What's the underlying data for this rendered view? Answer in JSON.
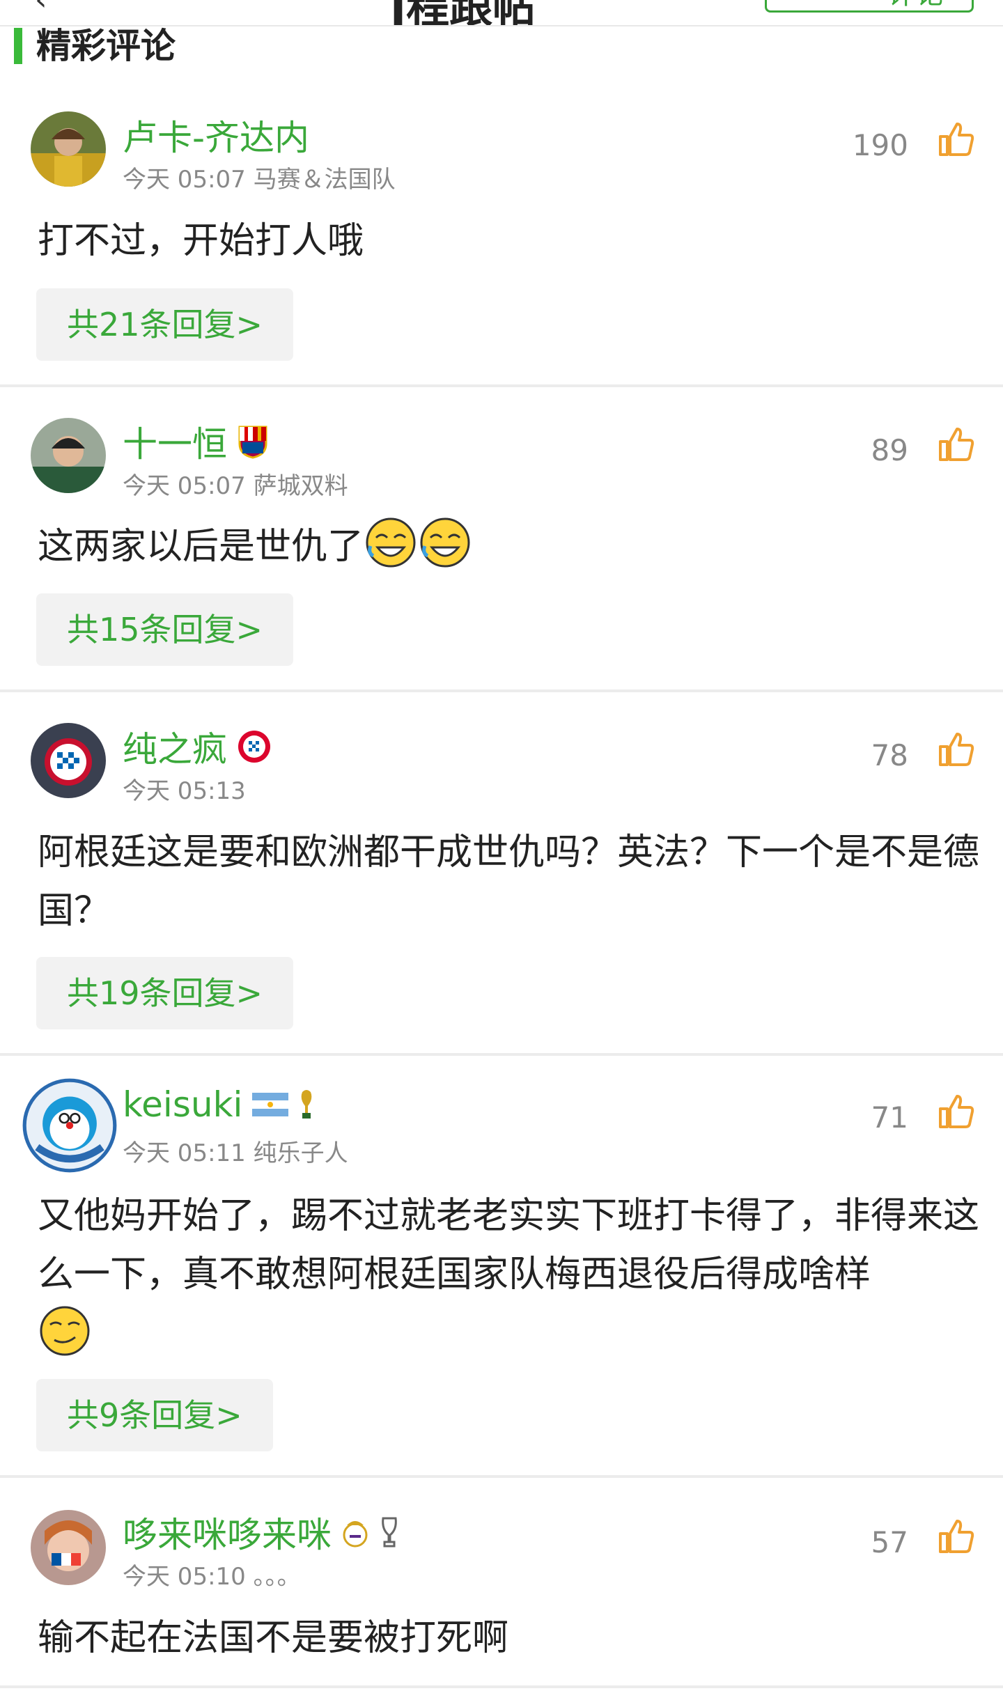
{
  "header": {
    "back_icon": "back-arrow-icon",
    "title": "ǀ程跟帖",
    "write_label": "评论"
  },
  "section": {
    "title": "精彩评论"
  },
  "comments": [
    {
      "username": "卢卡-齐达内",
      "time": "今天 05:07",
      "tag": "马赛＆法国队",
      "likes": "190",
      "text": "打不过，开始打人哦",
      "replies": "共21条回复>"
    },
    {
      "username": "十一恒",
      "time": "今天 05:07",
      "tag": "萨城双料",
      "likes": "89",
      "text": "这两家以后是世仇了",
      "replies": "共15条回复>"
    },
    {
      "username": "纯之疯",
      "time": "今天 05:13",
      "tag": "",
      "likes": "78",
      "text": "阿根廷这是要和欧洲都干成世仇吗？英法？下一个是不是德国？",
      "replies": "共19条回复>"
    },
    {
      "username": "keisuki",
      "time": "今天 05:11",
      "tag": "纯乐子人",
      "likes": "71",
      "text": "又他妈开始了，踢不过就老老实实下班打卡得了，非得来这么一下，真不敢想阿根廷国家队梅西退役后得成啥样",
      "replies": "共9条回复>"
    },
    {
      "username": "哆来咪哆来咪",
      "time": "今天 05:10",
      "tag": "。。。",
      "likes": "57",
      "text": "输不起在法国不是要被打死啊",
      "replies": ""
    }
  ],
  "colors": {
    "accent_green": "#3aa83a",
    "like_orange": "#f0a030",
    "meta_gray": "#888888"
  }
}
